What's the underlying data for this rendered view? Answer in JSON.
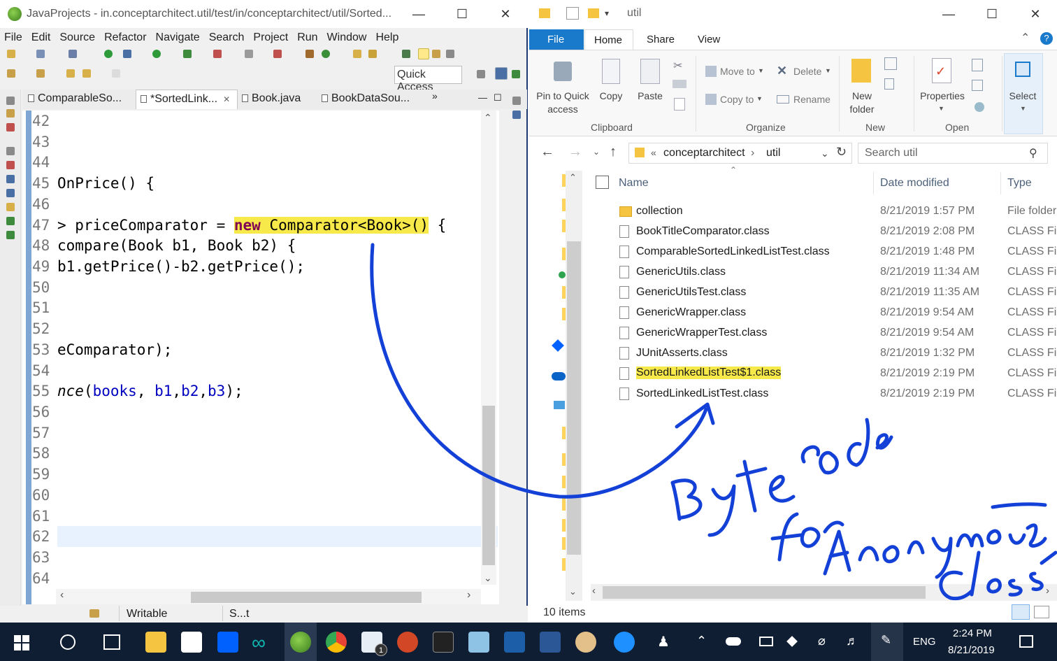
{
  "eclipse": {
    "title": "JavaProjects - in.conceptarchitect.util/test/in/conceptarchitect/util/Sorted...",
    "menu": [
      "File",
      "Edit",
      "Source",
      "Refactor",
      "Navigate",
      "Search",
      "Project",
      "Run",
      "Window",
      "Help"
    ],
    "quick_access": "Quick Access",
    "tabs": [
      "ComparableSo...",
      "*SortedLink...",
      "Book.java",
      "BookDataSou..."
    ],
    "tab_overflow": "»",
    "lines": [
      {
        "n": "42",
        "text": ""
      },
      {
        "n": "43",
        "text": ""
      },
      {
        "n": "44",
        "text": ""
      },
      {
        "n": "45",
        "text": "OnPrice() {"
      },
      {
        "n": "46",
        "text": ""
      },
      {
        "n": "47",
        "text": "> priceComparator = "
      },
      {
        "n": "48",
        "text": "compare(Book b1, Book b2) {"
      },
      {
        "n": "49",
        "text": "b1.getPrice()-b2.getPrice();"
      },
      {
        "n": "50",
        "text": ""
      },
      {
        "n": "51",
        "text": ""
      },
      {
        "n": "52",
        "text": ""
      },
      {
        "n": "53",
        "text": "eComparator);"
      },
      {
        "n": "54",
        "text": ""
      },
      {
        "n": "55",
        "text": ""
      },
      {
        "n": "56",
        "text": ""
      },
      {
        "n": "57",
        "text": ""
      },
      {
        "n": "58",
        "text": ""
      },
      {
        "n": "59",
        "text": ""
      },
      {
        "n": "60",
        "text": ""
      },
      {
        "n": "61",
        "text": ""
      },
      {
        "n": "62",
        "text": ""
      },
      {
        "n": "63",
        "text": ""
      },
      {
        "n": "64",
        "text": ""
      }
    ],
    "line47_new": "new",
    "line47_comparator": " Comparator<Book>()",
    "line47_brace": " {",
    "line55_method": "nce",
    "line55_open": "(",
    "line55_books": "books",
    "line55_sep1": ", ",
    "line55_b1": "b1",
    "line55_sep2": ",",
    "line55_b2": "b2",
    "line55_sep3": ",",
    "line55_b3": "b3",
    "line55_end": ");",
    "status_writable": "Writable",
    "status_insert": "S...t"
  },
  "explorer": {
    "title": "util",
    "ribbon_tabs": [
      "File",
      "Home",
      "Share",
      "View"
    ],
    "ribbon": {
      "pin": "Pin to Quick access",
      "copy": "Copy",
      "paste": "Paste",
      "move_to": "Move to",
      "copy_to": "Copy to",
      "delete": "Delete",
      "rename": "Rename",
      "new_folder": "New folder",
      "properties": "Properties",
      "select": "Select",
      "groups": [
        "Clipboard",
        "Organize",
        "New",
        "Open"
      ]
    },
    "path": [
      "conceptarchitect",
      "util"
    ],
    "path_prefix": "«",
    "search_placeholder": "Search util",
    "columns": [
      "Name",
      "Date modified",
      "Type"
    ],
    "files": [
      {
        "name": "collection",
        "date": "8/21/2019 1:57 PM",
        "type": "File folder",
        "folder": true
      },
      {
        "name": "BookTitleComparator.class",
        "date": "8/21/2019 2:08 PM",
        "type": "CLASS File"
      },
      {
        "name": "ComparableSortedLinkedListTest.class",
        "date": "8/21/2019 1:48 PM",
        "type": "CLASS File"
      },
      {
        "name": "GenericUtils.class",
        "date": "8/21/2019 11:34 AM",
        "type": "CLASS File"
      },
      {
        "name": "GenericUtilsTest.class",
        "date": "8/21/2019 11:35 AM",
        "type": "CLASS File"
      },
      {
        "name": "GenericWrapper.class",
        "date": "8/21/2019 9:54 AM",
        "type": "CLASS File"
      },
      {
        "name": "GenericWrapperTest.class",
        "date": "8/21/2019 9:54 AM",
        "type": "CLASS File"
      },
      {
        "name": "JUnitAsserts.class",
        "date": "8/21/2019 1:32 PM",
        "type": "CLASS File"
      },
      {
        "name": "SortedLinkedListTest$1.class",
        "date": "8/21/2019 2:19 PM",
        "type": "CLASS File",
        "highlight": true
      },
      {
        "name": "SortedLinkedListTest.class",
        "date": "8/21/2019 2:19 PM",
        "type": "CLASS File"
      }
    ],
    "item_count": "10 items"
  },
  "taskbar": {
    "lang": "ENG",
    "time": "2:24 PM",
    "date": "8/21/2019",
    "mail_badge": "1"
  },
  "colors": {
    "highlight": "#f7e94a",
    "ink": "#1340d6",
    "taskbar": "#0f1e33",
    "ribbon_file": "#1979ca"
  }
}
